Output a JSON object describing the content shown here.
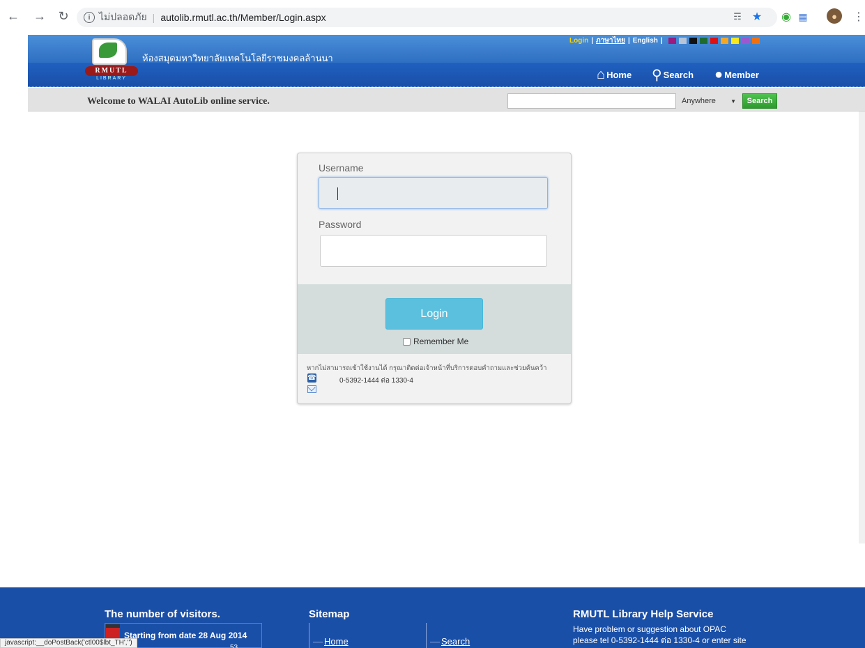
{
  "browser": {
    "security_label": "ไม่ปลอดภัย",
    "url": "autolib.rmutl.ac.th/Member/Login.aspx"
  },
  "header": {
    "site_name": "ห้องสมุดมหาวิทยาลัยเทคโนโลยีราชมงคลล้านนา",
    "logo_text": "RMUTL",
    "logo_sub": "LIBRARY",
    "top_links": {
      "login": "Login",
      "thai": "ภาษาไทย",
      "english": "English"
    },
    "theme_colors": [
      "#9b1b7f",
      "#b8c4d8",
      "#111111",
      "#1f6b2f",
      "#e01010",
      "#f5a623",
      "#f8e71c",
      "#9b59d0",
      "#f07010"
    ],
    "nav": {
      "home": "Home",
      "search": "Search",
      "member": "Member"
    }
  },
  "search_bar": {
    "welcome": "Welcome to WALAI AutoLib online service.",
    "scope_selected": "Anywhere",
    "button": "Search"
  },
  "login": {
    "username_label": "Username",
    "password_label": "Password",
    "button": "Login",
    "remember": "Remember Me",
    "help_text": "หากไม่สามารถเข้าใช้งานได้ กรุณาติดต่อเจ้าหน้าที่บริการตอบคำถามและช่วยค้นคว้า",
    "phone": "0-5392-1444 ต่อ 1330-4"
  },
  "footer": {
    "visitors_title": "The number of visitors.",
    "start_text": "Starting from date  28 Aug 2014",
    "count_partial": "53",
    "sitemap_title": "Sitemap",
    "sitemap_links": [
      "Home",
      "Search"
    ],
    "help_title": "RMUTL Library Help Service",
    "help_line1": "Have problem or suggestion about OPAC",
    "help_line2": "please tel 0-5392-1444 ต่อ 1330-4 or enter site"
  },
  "status_bar": "javascript:__doPostBack('ctl00$lbt_TH','')"
}
